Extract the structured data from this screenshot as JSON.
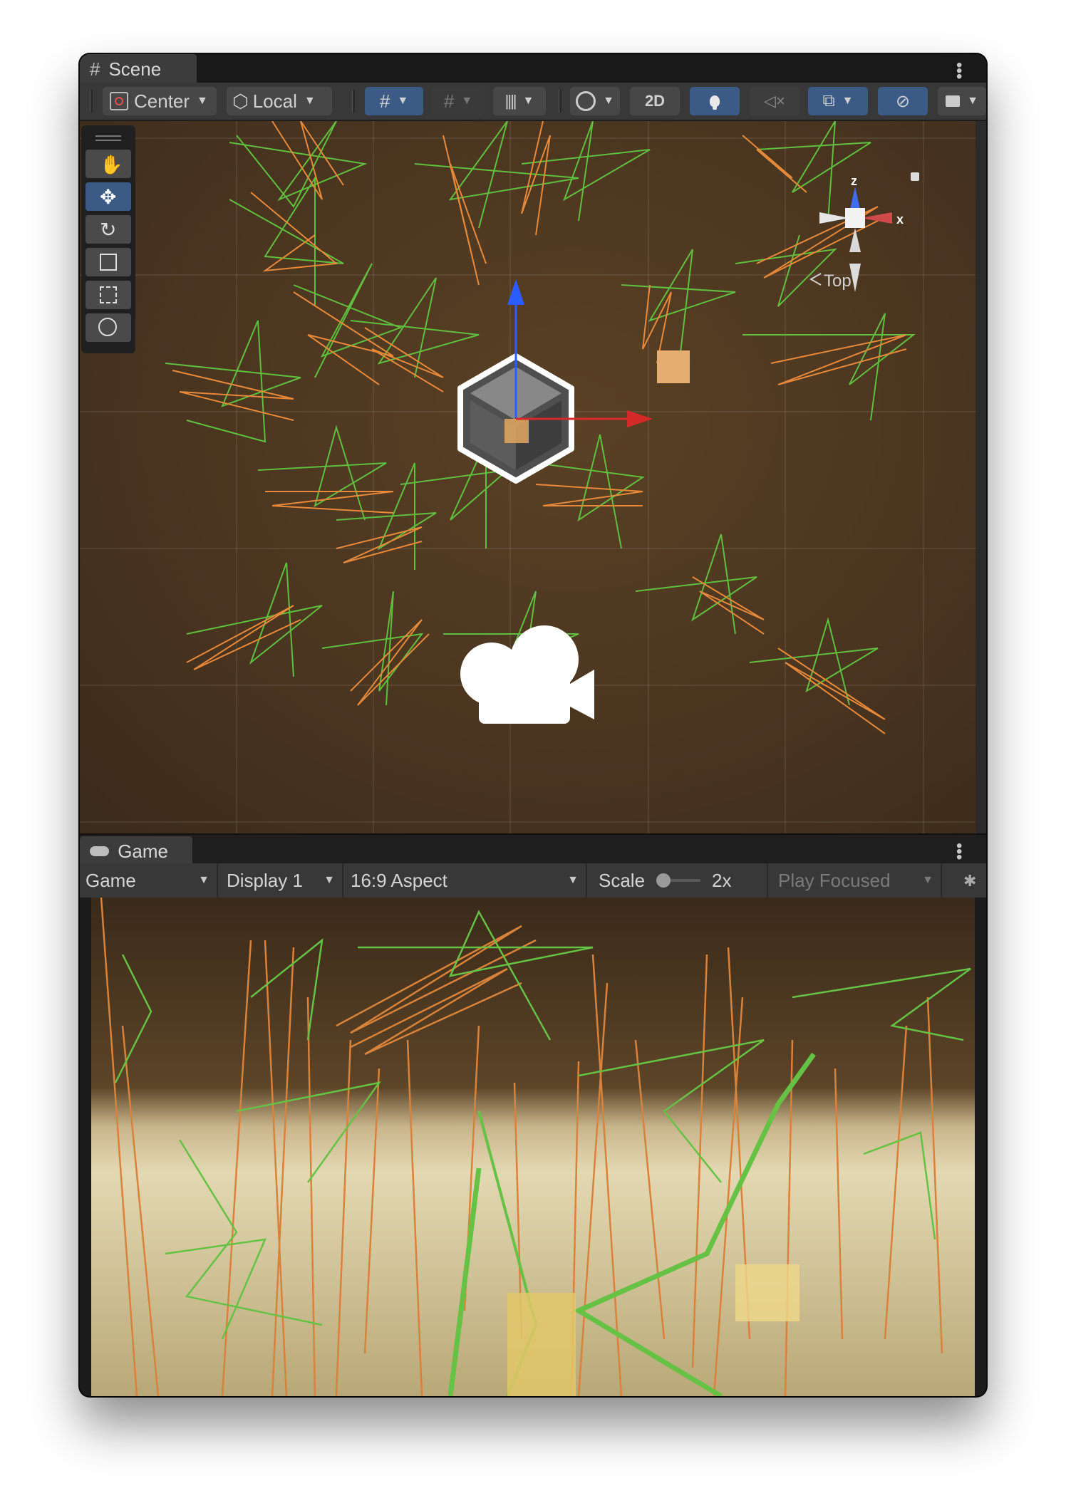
{
  "scene_tab": {
    "label": "Scene",
    "icon": "hash-icon"
  },
  "scene_toolbar": {
    "pivot_label": "Center",
    "space_label": "Local",
    "mode_2d": "2D"
  },
  "orientation_gizmo": {
    "z_axis": "z",
    "x_axis": "x",
    "view_label": "Top"
  },
  "game_tab": {
    "label": "Game",
    "icon": "gamepad-icon"
  },
  "game_toolbar": {
    "view_mode": "Game",
    "display": "Display 1",
    "aspect": "16:9 Aspect",
    "scale_label": "Scale",
    "scale_value": "2x",
    "play_mode": "Play Focused"
  },
  "colors": {
    "accent_blue": "#3b5b86",
    "axis_red": "#d42a2a",
    "axis_blue": "#2a5cff",
    "grass_green": "#6cc94a",
    "grass_orange": "#e08a3a"
  }
}
